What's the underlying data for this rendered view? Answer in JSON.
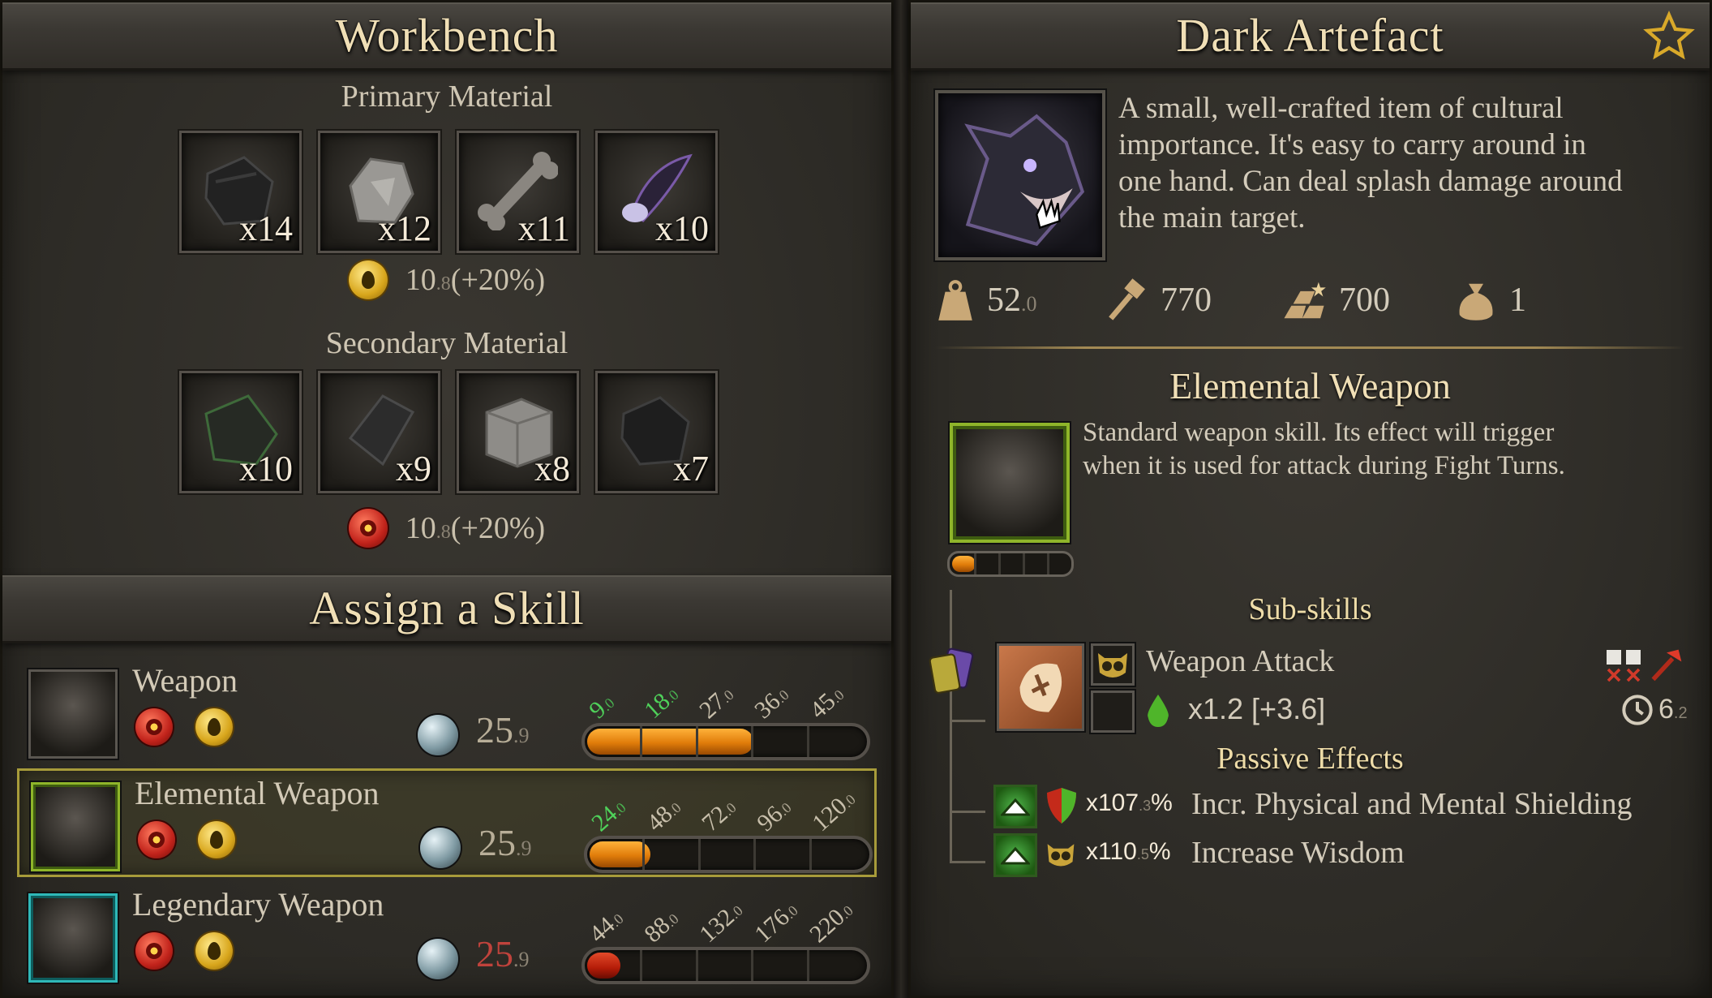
{
  "workbench": {
    "title": "Workbench",
    "primary_label": "Primary Material",
    "primary_materials": [
      {
        "count": "x14",
        "icon": "dark-leather-icon"
      },
      {
        "count": "x12",
        "icon": "stone-icon"
      },
      {
        "count": "x11",
        "icon": "bone-icon"
      },
      {
        "count": "x10",
        "icon": "dark-feather-icon"
      }
    ],
    "primary_bonus": {
      "value": "10",
      "decimal": ".8",
      "pct": "(+20%)"
    },
    "secondary_label": "Secondary Material",
    "secondary_materials": [
      {
        "count": "x10",
        "icon": "mossy-cloth-icon"
      },
      {
        "count": "x9",
        "icon": "dark-slab-icon"
      },
      {
        "count": "x8",
        "icon": "stone-block-icon"
      },
      {
        "count": "x7",
        "icon": "dark-leather-icon"
      }
    ],
    "secondary_bonus": {
      "value": "10",
      "decimal": ".8",
      "pct": "(+20%)"
    }
  },
  "assign": {
    "title": "Assign a Skill",
    "skills": [
      {
        "name": "Weapon",
        "cost": "25",
        "cost_dec": ".9",
        "ticks": [
          "9",
          "18",
          "27",
          "36",
          "45"
        ],
        "tick_dec": ".0",
        "green_ticks": 2,
        "fill": 0.6
      },
      {
        "name": "Elemental Weapon",
        "cost": "25",
        "cost_dec": ".9",
        "ticks": [
          "24",
          "48",
          "72",
          "96",
          "120"
        ],
        "tick_dec": ".0",
        "green_ticks": 1,
        "fill": 0.22
      },
      {
        "name": "Legendary Weapon",
        "cost": "25",
        "cost_dec": ".9",
        "ticks": [
          "44",
          "88",
          "132",
          "176",
          "220"
        ],
        "tick_dec": ".0",
        "green_ticks": 0,
        "fill": 0.12
      }
    ]
  },
  "artefact": {
    "title": "Dark Artefact",
    "description_lines": [
      "A small, well-crafted item of cultural",
      "importance. It's easy to carry around in",
      "one hand. Can deal splash damage around",
      "the main target."
    ],
    "stats": {
      "weight": "52",
      "weight_dec": ".0",
      "hammer": "770",
      "value": "700",
      "bag": "1"
    },
    "skill_title": "Elemental Weapon",
    "skill_desc_lines": [
      "Standard weapon skill. Its effect will trigger",
      "when it is used for attack during Fight Turns."
    ],
    "skill_progress": 0.2,
    "subskills_label": "Sub-skills",
    "subskill": {
      "name": "Weapon Attack",
      "mult": "x1.2 [+3.6]",
      "cooldown": "6",
      "cooldown_dec": ".2"
    },
    "passive_label": "Passive Effects",
    "passives": [
      {
        "mult": "x107",
        "mult_dec": ".3",
        "pct": "%",
        "text": "Incr. Physical and Mental Shielding"
      },
      {
        "mult": "x110",
        "mult_dec": ".5",
        "pct": "%",
        "text": "Increase Wisdom"
      }
    ]
  },
  "colors": {
    "accent_gold": "#f0dfb6",
    "progress_orange": "#e07c0a",
    "tick_green": "#4fd15a",
    "selected_border": "#a79b3a",
    "cost_red": "#c0433c"
  }
}
